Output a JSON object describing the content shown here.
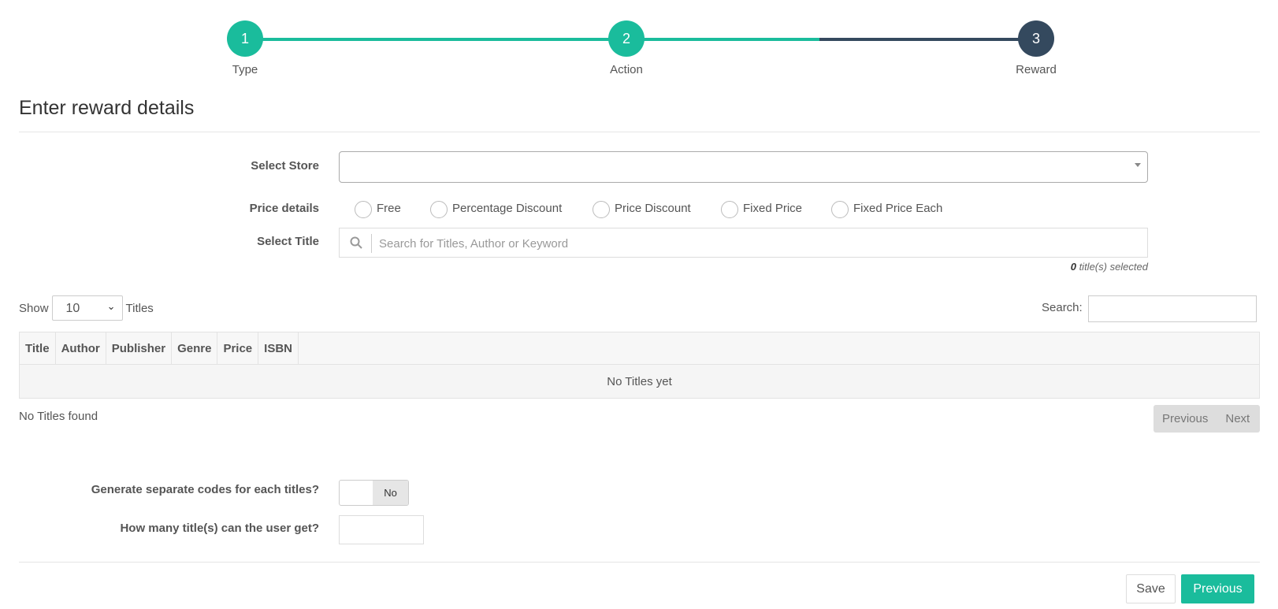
{
  "wizard": {
    "steps": [
      {
        "number": "1",
        "label": "Type"
      },
      {
        "number": "2",
        "label": "Action"
      },
      {
        "number": "3",
        "label": "Reward"
      }
    ],
    "current_step": 3,
    "colors": {
      "done": "#1abc9c",
      "current": "#34495e"
    }
  },
  "page_title": "Enter reward details",
  "form": {
    "store_label": "Select Store",
    "store_value": "",
    "price_label": "Price details",
    "price_options": [
      "Free",
      "Percentage Discount",
      "Price Discount",
      "Fixed Price",
      "Fixed Price Each"
    ],
    "title_label": "Select Title",
    "title_placeholder": "Search for Titles, Author or Keyword",
    "selected_count": "0",
    "selected_suffix": " title(s) selected"
  },
  "table": {
    "show_label": "Show",
    "page_length": "10",
    "length_suffix": "Titles",
    "search_label": "Search:",
    "columns": [
      "Title",
      "Author",
      "Publisher",
      "Genre",
      "Price",
      "ISBN"
    ],
    "empty_message": "No Titles yet",
    "info": "No Titles found",
    "pager": {
      "previous": "Previous",
      "next": "Next"
    }
  },
  "options": {
    "separate_codes_label": "Generate separate codes for each titles?",
    "separate_codes_value": "No",
    "qty_label": "How many title(s) can the user get?",
    "qty_value": ""
  },
  "footer": {
    "save_label": "Save",
    "previous_label": "Previous"
  },
  "colors": {
    "accent": "#1abc9c",
    "dark": "#34495e"
  }
}
